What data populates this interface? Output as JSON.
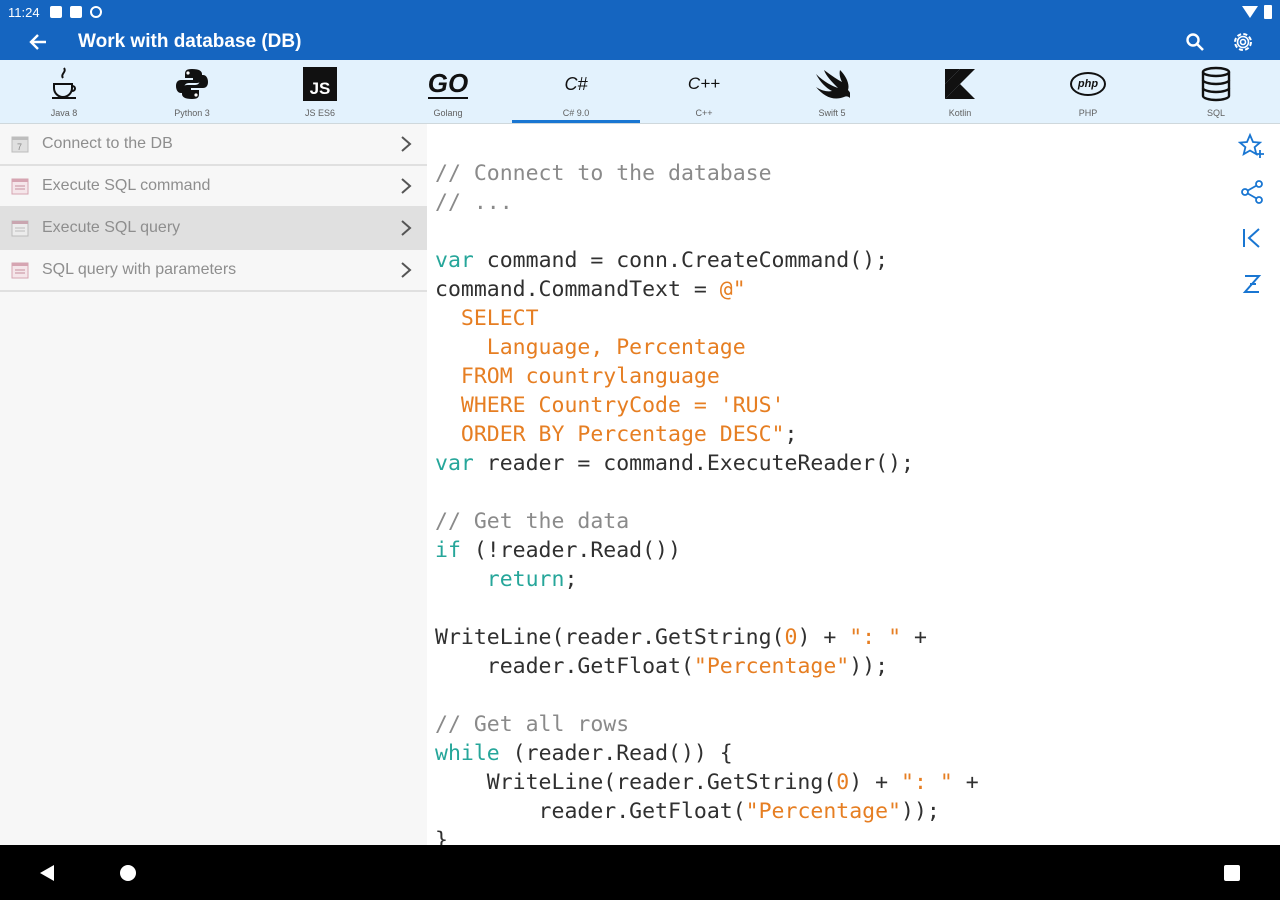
{
  "status": {
    "time": "11:24"
  },
  "appbar": {
    "title": "Work with database (DB)"
  },
  "languages": [
    {
      "name": "Java 8",
      "logo": "java-logo"
    },
    {
      "name": "Python 3",
      "logo": "python-logo"
    },
    {
      "name": "JS ES6",
      "logo": "js-logo",
      "logo_text": "JS"
    },
    {
      "name": "Golang",
      "logo": "go-logo",
      "logo_text": "GO"
    },
    {
      "name": "C# 9.0",
      "logo": "csharp-logo",
      "logo_text": "C#"
    },
    {
      "name": "C++",
      "logo": "cpp-logo",
      "logo_text": "C++"
    },
    {
      "name": "Swift 5",
      "logo": "swift-logo"
    },
    {
      "name": "Kotlin",
      "logo": "kotlin-logo"
    },
    {
      "name": "PHP",
      "logo": "php-logo",
      "logo_text": "php"
    },
    {
      "name": "SQL",
      "logo": "sql-logo"
    }
  ],
  "topics": [
    {
      "label": "Connect to the DB"
    },
    {
      "label": "Execute SQL command"
    },
    {
      "label": "Execute SQL query"
    },
    {
      "label": "SQL query with parameters"
    }
  ],
  "code": {
    "l1": "// Connect to the database",
    "l2": "// ...",
    "l4_kw": "var",
    "l4_rest": " command = conn.CreateCommand();",
    "l5_a": "command.CommandText = ",
    "l5_str": "@\"",
    "l6": "  SELECT",
    "l7": "    Language, Percentage",
    "l8": "  FROM countrylanguage",
    "l9": "  WHERE CountryCode = 'RUS'",
    "l10_str": "  ORDER BY Percentage DESC\"",
    "l10_end": ";",
    "l11_kw": "var",
    "l11_rest": " reader = command.ExecuteReader();",
    "l13": "// Get the data",
    "l14_kw": "if",
    "l14_rest": " (!reader.Read())",
    "l15_kw": "    return",
    "l15_end": ";",
    "l17_a": "WriteLine(reader.GetString(",
    "l17_num": "0",
    "l17_b": ") + ",
    "l17_str": "\": \"",
    "l17_c": " +",
    "l18_a": "    reader.GetFloat(",
    "l18_str": "\"Percentage\"",
    "l18_b": "));",
    "l20": "// Get all rows",
    "l21_kw": "while",
    "l21_rest": " (reader.Read()) {",
    "l22_a": "    WriteLine(reader.GetString(",
    "l22_num": "0",
    "l22_b": ") + ",
    "l22_str": "\": \"",
    "l22_c": " +",
    "l23_a": "        reader.GetFloat(",
    "l23_str": "\"Percentage\"",
    "l23_b": "));",
    "l24": "}"
  },
  "colors": {
    "primary": "#1565c0",
    "accent": "#1976d2",
    "keyword": "#26a69a",
    "string": "#e67e22",
    "comment": "#8a8a8a"
  }
}
